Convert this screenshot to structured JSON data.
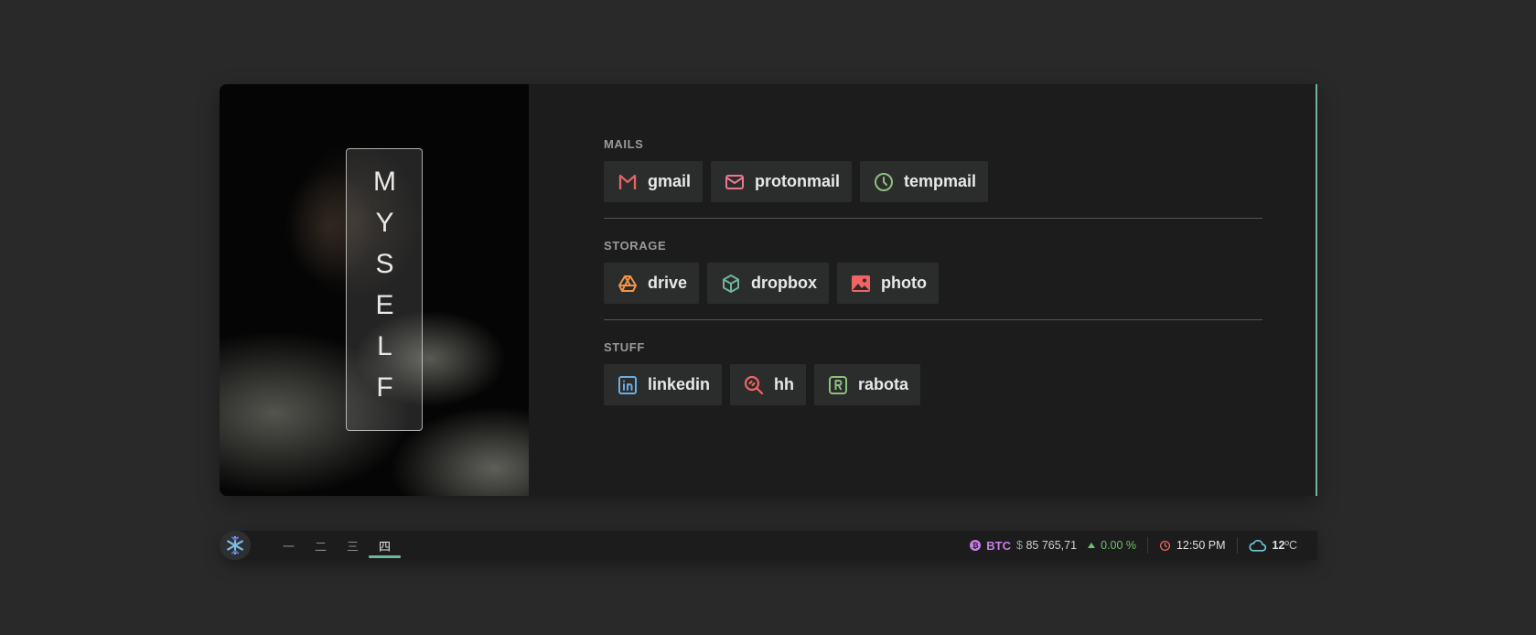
{
  "hero": {
    "title": "MYSELF"
  },
  "sections": [
    {
      "title": "MAILS",
      "links": [
        {
          "label": "gmail",
          "icon": "gmail-icon",
          "color": "#e06666"
        },
        {
          "label": "protonmail",
          "icon": "mail-icon",
          "color": "#e77a8e"
        },
        {
          "label": "tempmail",
          "icon": "clock-icon",
          "color": "#8fbf7f"
        }
      ]
    },
    {
      "title": "STORAGE",
      "links": [
        {
          "label": "drive",
          "icon": "google-drive-icon",
          "color": "#f0944a"
        },
        {
          "label": "dropbox",
          "icon": "box-icon",
          "color": "#6fb59b"
        },
        {
          "label": "photo",
          "icon": "photo-icon",
          "color": "#f06464"
        }
      ]
    },
    {
      "title": "STUFF",
      "links": [
        {
          "label": "linkedin",
          "icon": "linkedin-icon",
          "color": "#6aaee0"
        },
        {
          "label": "hh",
          "icon": "search-zoom-icon",
          "color": "#f06464"
        },
        {
          "label": "rabota",
          "icon": "r-badge-icon",
          "color": "#8fbf7f"
        }
      ]
    }
  ],
  "bar": {
    "workspaces": [
      "一",
      "二",
      "三",
      "四"
    ],
    "active_workspace": 3,
    "btc": {
      "label": "BTC",
      "currency": "$",
      "price": "85 765,71",
      "change": "0.00 %"
    },
    "clock": "12:50 PM",
    "weather": {
      "value": "12",
      "unit": "ºC"
    }
  },
  "colors": {
    "accent": "#6fb59b",
    "btc": "#c77ee6",
    "positive": "#6ec16e",
    "clock": "#f06464",
    "weather": "#6fc8d8"
  }
}
